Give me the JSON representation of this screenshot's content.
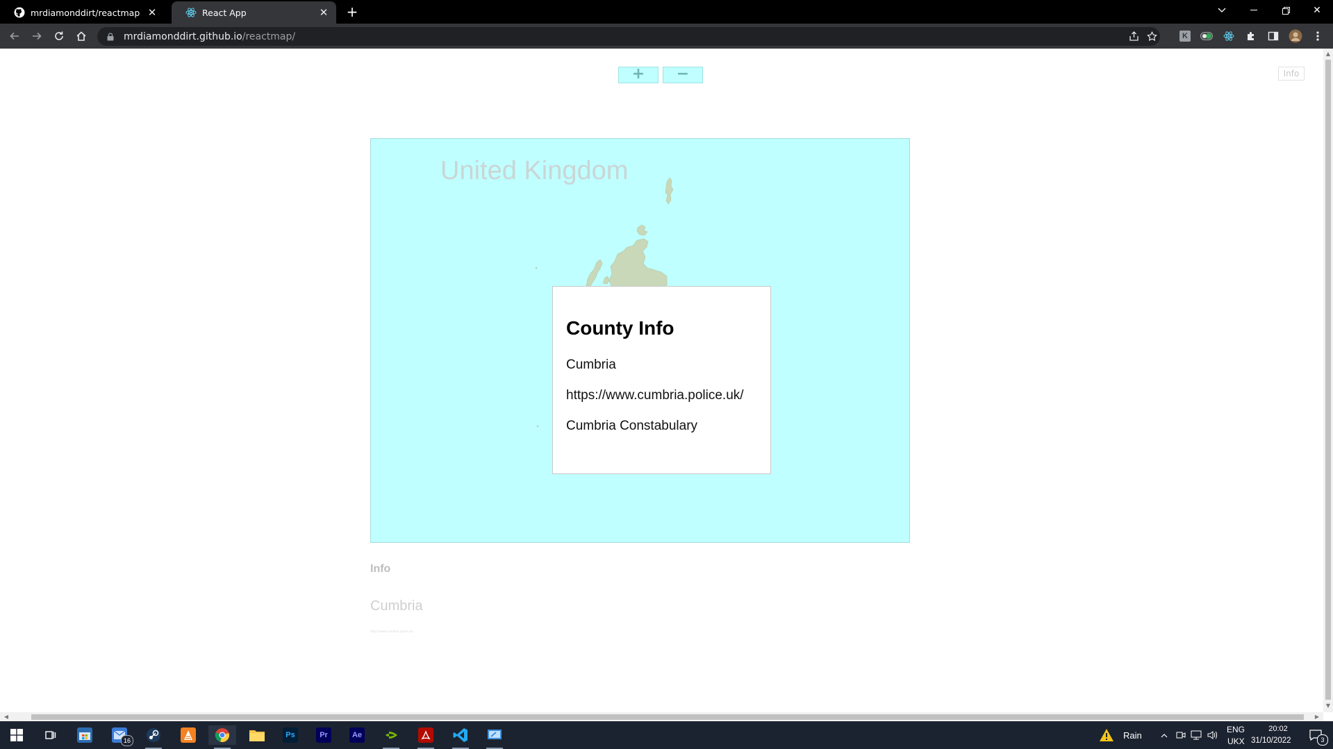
{
  "browser": {
    "tabs": [
      {
        "title": "mrdiamonddirt/reactmap",
        "favicon": "github-icon",
        "active": false
      },
      {
        "title": "React App",
        "favicon": "react-icon",
        "active": true
      }
    ],
    "url_host": "mrdiamonddirt.github.io",
    "url_path": "/reactmap/"
  },
  "page": {
    "zoom_in_label": "+",
    "zoom_out_label": "−",
    "info_toggle_label": "Info",
    "map": {
      "title": "United Kingdom",
      "colors": {
        "sea": "#bfffff",
        "land": "#c8d8b8"
      }
    },
    "popup": {
      "heading": "County Info",
      "county": "Cumbria",
      "website": "https://www.cumbria.police.uk/",
      "force": "Cumbria Constabulary"
    },
    "info_panel": {
      "heading": "Info",
      "county": "Cumbria",
      "url": "https://www.cumbria.police.uk/"
    }
  },
  "taskbar": {
    "mail_badge": "16",
    "weather": "Rain",
    "language": "ENG",
    "layout": "UKX",
    "time": "20:02",
    "date": "31/10/2022",
    "notifications": "3"
  }
}
